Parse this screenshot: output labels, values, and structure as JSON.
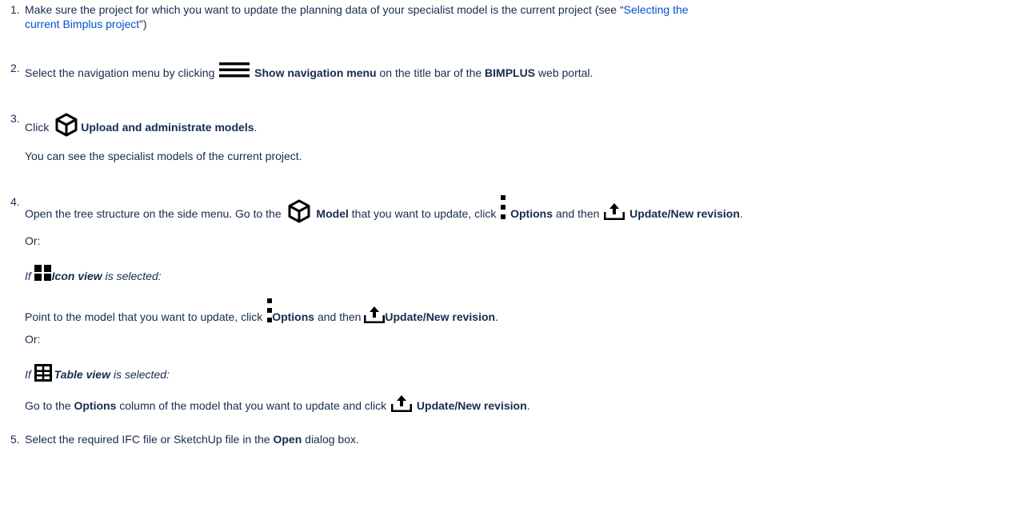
{
  "steps": [
    {
      "number": "1.",
      "part1": "Make sure the project for which you want to update the planning data of your specialist model is the current project (see “",
      "link_line1": "Selecting the",
      "link_line2": "current Bimplus project",
      "part2": "”)"
    },
    {
      "number": "2.",
      "pre": "Select the navigation menu by clicking",
      "icon": "hamburger-menu-icon",
      "bold": "Show navigation menu",
      "mid": "on the title bar of the",
      "bold2": "BIMPLUS",
      "post": "web portal."
    },
    {
      "number": "3.",
      "pre": "Click",
      "icon": "cube-icon",
      "bold": "Upload and administrate models",
      "post": ".",
      "note": "You can see the specialist models of the current project."
    },
    {
      "number": "4.",
      "pre": "Open the tree structure on the side menu. Go to the",
      "icon_model": "cube-icon",
      "bold_model": "Model",
      "mid1": "that you want to update, click",
      "icon_options": "vertical-dots-icon",
      "bold_options": "Options",
      "mid2": "and then",
      "icon_update": "upload-icon",
      "bold_update": "Update/New revision",
      "post": ".",
      "or1": "Or:",
      "if_prefix1": "If",
      "icon_view": "grid-icon",
      "icon_view_label": "Icon view",
      "if_suffix1": "is selected:",
      "iv_pre": "Point to the model that you want to update, click",
      "iv_options": "Options",
      "iv_mid": "and then",
      "iv_update": "Update/New revision",
      "iv_post": ".",
      "or2": "Or:",
      "if_prefix2": "If",
      "table_icon": "table-icon",
      "table_view_label": "Table view",
      "if_suffix2": "is selected:",
      "tv_pre": "Go to the",
      "tv_options": "Options",
      "tv_mid": "column of the model that you want to update and click",
      "tv_update": "Update/New revision",
      "tv_post": "."
    },
    {
      "number": "5.",
      "pre": "Select the required IFC file or SketchUp file in the",
      "bold": "Open",
      "post": "dialog box."
    }
  ]
}
